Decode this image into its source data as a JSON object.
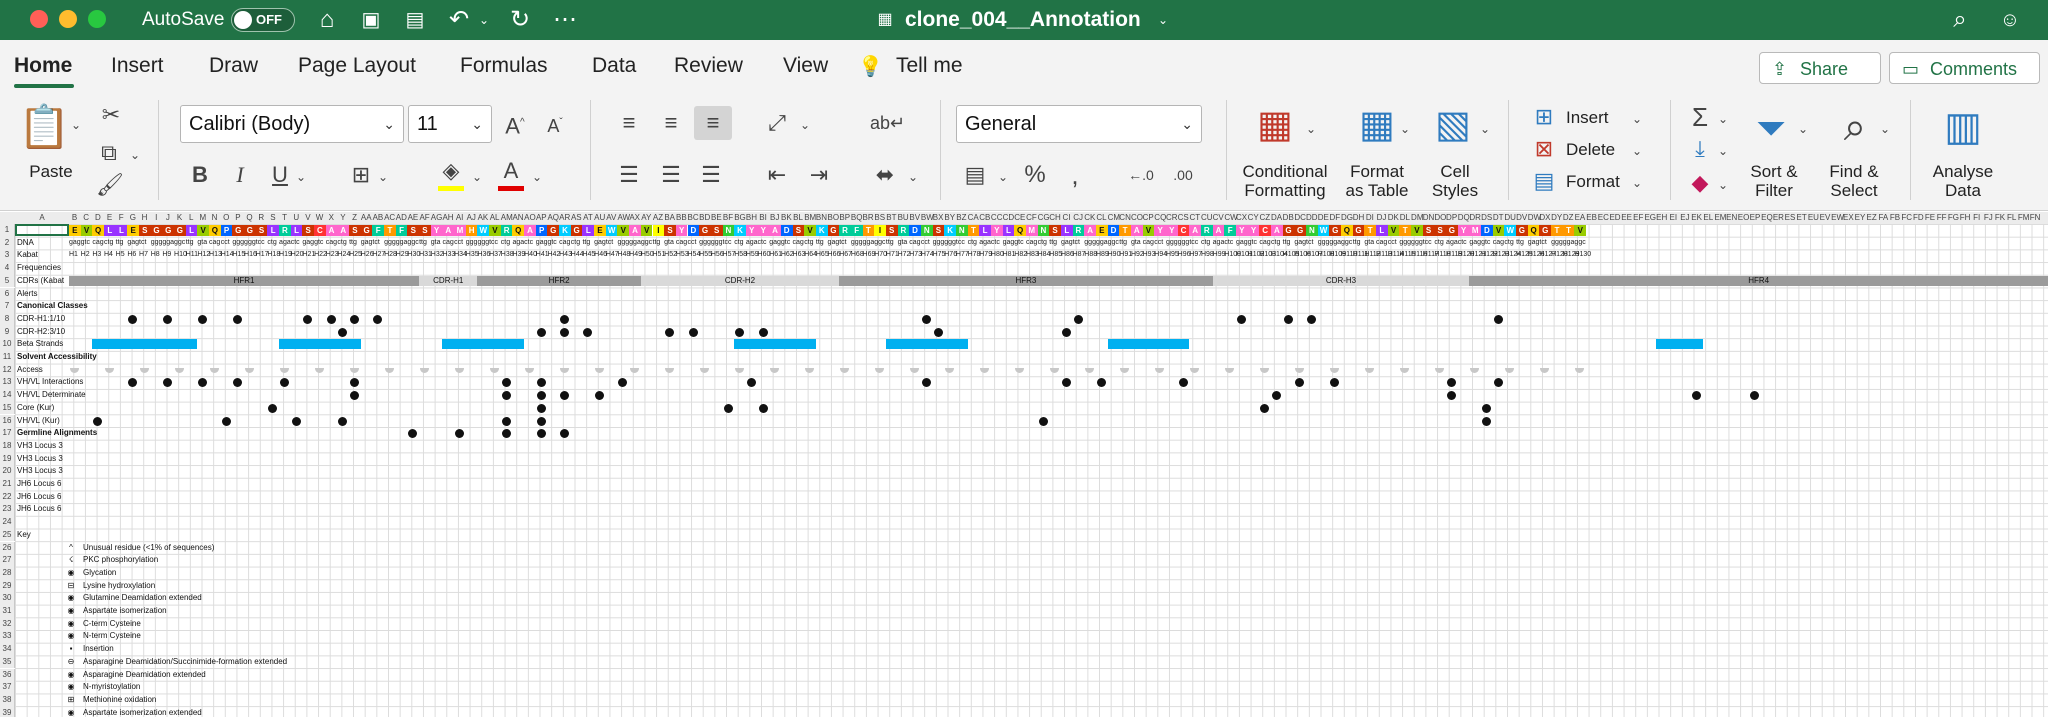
{
  "titlebar": {
    "autosave_label": "AutoSave",
    "autosave_state": "OFF",
    "doc_title": "clone_004__Annotation",
    "colors": {
      "bg": "#217346",
      "close": "#ff5f57",
      "min": "#febc2e",
      "max": "#28c840"
    }
  },
  "tabs": [
    "Home",
    "Insert",
    "Draw",
    "Page Layout",
    "Formulas",
    "Data",
    "Review",
    "View"
  ],
  "tell_me": "Tell me",
  "share_label": "Share",
  "comments_label": "Comments",
  "ribbon": {
    "paste": "Paste",
    "font_name": "Calibri (Body)",
    "font_size": "11",
    "number_format": "General",
    "conditional_formatting": [
      "Conditional",
      "Formatting"
    ],
    "format_as_table": [
      "Format",
      "as Table"
    ],
    "cell_styles": [
      "Cell",
      "Styles"
    ],
    "insert": "Insert",
    "delete": "Delete",
    "format": "Format",
    "sort_filter": [
      "Sort &",
      "Filter"
    ],
    "find_select": [
      "Find &",
      "Select"
    ],
    "analyse_data": [
      "Analyse",
      "Data"
    ]
  },
  "sheet": {
    "row_labels": [
      {
        "row": "1",
        "text": ""
      },
      {
        "row": "2",
        "text": "DNA"
      },
      {
        "row": "3",
        "text": "Kabat"
      },
      {
        "row": "4",
        "text": "Frequencies"
      },
      {
        "row": "5",
        "text": "CDRs (Kabat"
      },
      {
        "row": "6",
        "text": "Alerts"
      },
      {
        "row": "7",
        "text": "Canonical Classes",
        "bold": true
      },
      {
        "row": "8",
        "text": "CDR-H1:1/10"
      },
      {
        "row": "9",
        "text": "CDR-H2:3/10"
      },
      {
        "row": "10",
        "text": "Beta Strands"
      },
      {
        "row": "11",
        "text": "Solvent Accessibility",
        "bold": true
      },
      {
        "row": "12",
        "text": "Access"
      },
      {
        "row": "13",
        "text": "VH/VL Interactions"
      },
      {
        "row": "14",
        "text": "VH/VL Determinate"
      },
      {
        "row": "15",
        "text": "Core (Kur)"
      },
      {
        "row": "16",
        "text": "VH/VL (Kur)"
      },
      {
        "row": "17",
        "text": "Germline Alignments",
        "bold": true
      },
      {
        "row": "18",
        "text": "VH3 Locus 3"
      },
      {
        "row": "19",
        "text": "VH3 Locus 3"
      },
      {
        "row": "20",
        "text": "VH3 Locus 3"
      },
      {
        "row": "21",
        "text": "JH6 Locus 6"
      },
      {
        "row": "22",
        "text": "JH6 Locus 6"
      },
      {
        "row": "23",
        "text": "JH6 Locus 6"
      },
      {
        "row": "24",
        "text": ""
      },
      {
        "row": "25",
        "text": "Key"
      }
    ],
    "regions": [
      {
        "label": "HFR1",
        "shade": "#9b9b9b"
      },
      {
        "label": "CDR-H1",
        "shade": "#d9d9d9"
      },
      {
        "label": "HFR2",
        "shade": "#9b9b9b"
      },
      {
        "label": "CDR-H2",
        "shade": "#d9d9d9"
      },
      {
        "label": "HFR3",
        "shade": "#9b9b9b"
      },
      {
        "label": "CDR-H3",
        "shade": "#d9d9d9"
      },
      {
        "label": "HFR4",
        "shade": "#9b9b9b"
      }
    ],
    "sequence": "EVQLLESGGGLVQPGGSLRLSCAASGFTFSSYAMHWVRQAPGKGLEWVAVISYDGSNKYYADSVKGRFTISRDNSKNTLYLQMNSLRAEDTAVYYCARAFYYCAGGNWGQGTLVTVSSGYMDVWGQGTTV",
    "key": [
      {
        "symbol": "^",
        "text": "Unusual residue (<1% of sequences)"
      },
      {
        "symbol": "☇",
        "text": "PKC phosphorylation"
      },
      {
        "symbol": "◉",
        "text": "Glycation"
      },
      {
        "symbol": "⊟",
        "text": "Lysine hydroxylation"
      },
      {
        "symbol": "◉",
        "text": "Glutamine Deamidation extended"
      },
      {
        "symbol": "◉",
        "text": "Aspartate isomerization"
      },
      {
        "symbol": "◉",
        "text": "C-term Cysteine"
      },
      {
        "symbol": "◉",
        "text": "N-term Cysteine"
      },
      {
        "symbol": "▪",
        "text": "Insertion"
      },
      {
        "symbol": "⊖",
        "text": "Asparagine Deamidation/Succinimide-formation extended"
      },
      {
        "symbol": "◉",
        "text": "Asparagine Deamidation extended"
      },
      {
        "symbol": "◉",
        "text": "N-myristoylation"
      },
      {
        "symbol": "⊞",
        "text": "Methionine oxidation"
      },
      {
        "symbol": "◉",
        "text": "Aspartate isomerization extended"
      }
    ]
  }
}
